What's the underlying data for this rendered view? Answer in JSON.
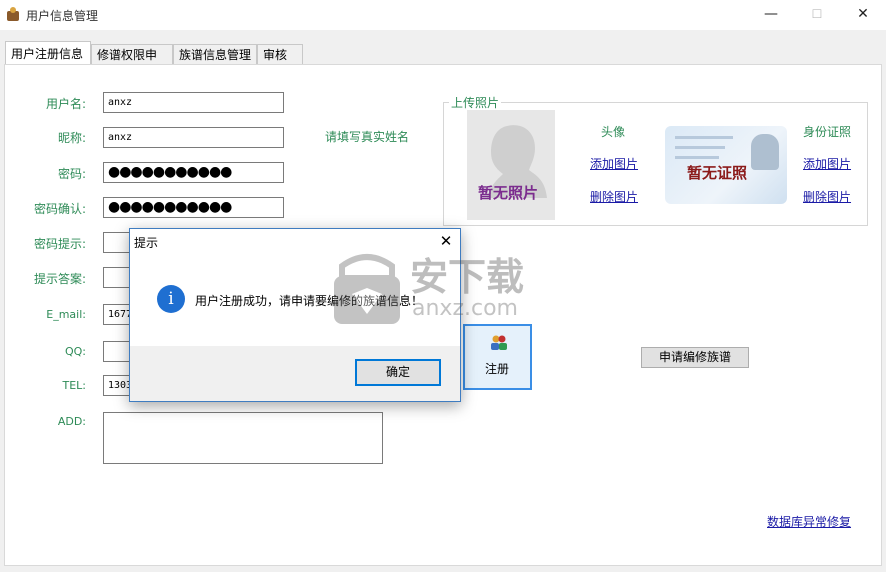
{
  "window": {
    "title": "用户信息管理",
    "minimize": "—",
    "maximize": "☐",
    "close": "✕"
  },
  "tabs": [
    "用户注册信息",
    "修谱权限申请",
    "族谱信息管理",
    "审核"
  ],
  "form": {
    "username_label": "用户名:",
    "username_value": "anxz",
    "nickname_label": "昵称:",
    "nickname_value": "anxz",
    "nickname_hint": "请填写真实姓名",
    "password_label": "密码:",
    "password_value": "●●●●●●●●●●●",
    "password_confirm_label": "密码确认:",
    "password_confirm_value": "●●●●●●●●●●●",
    "password_hint_label": "密码提示:",
    "password_hint_value": "",
    "hint_answer_label": "提示答案:",
    "hint_answer_value": "",
    "email_label": "E_mail:",
    "email_value": "1677",
    "qq_label": "QQ:",
    "qq_value": "",
    "tel_label": "TEL:",
    "tel_value": "1303",
    "add_label": "ADD:",
    "add_value": ""
  },
  "photos": {
    "group_title": "上传照片",
    "avatar_placeholder": "暂无照片",
    "avatar_title": "头像",
    "id_placeholder": "暂无证照",
    "id_title": "身份证照",
    "add_picture": "添加图片",
    "delete_picture": "删除图片"
  },
  "buttons": {
    "register": "注册",
    "apply_edit": "申请编修族谱",
    "db_repair": "数据库异常修复"
  },
  "dialog": {
    "title": "提示",
    "message": "用户注册成功，请申请要编修的族谱信息！",
    "ok": "确定",
    "info_glyph": "i"
  },
  "watermark": {
    "brand": "安下载",
    "domain": "anxz.com"
  },
  "colors": {
    "label_green": "#2e8b57",
    "link_blue": "#1a1aa6",
    "dialog_border": "#3f7cc0",
    "focus_blue": "#0078d7"
  }
}
